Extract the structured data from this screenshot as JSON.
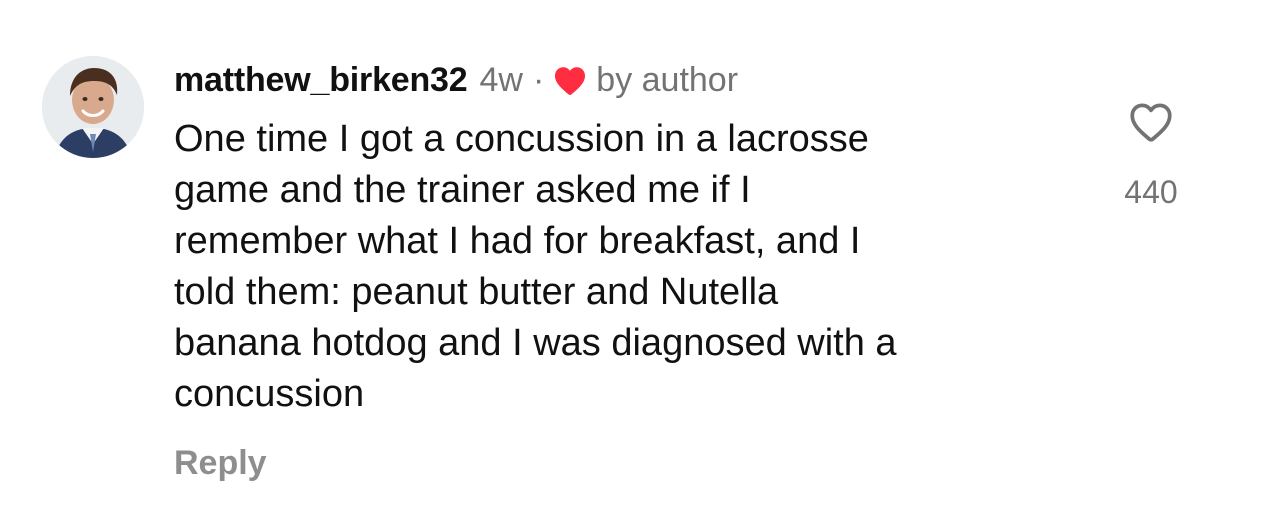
{
  "comment": {
    "username": "matthew_birken32",
    "time": "4w",
    "separator": "·",
    "by_author": "by author",
    "text": "One time I got a concussion in a lacrosse\ngame and the trainer asked me if I\nremember what I had for breakfast, and I\ntold them: peanut butter and Nutella\nbanana hotdog and I was diagnosed with a\nconcussion",
    "reply_label": "Reply",
    "like_count": "440"
  },
  "icons": {
    "avatar": "avatar",
    "author_heart": "heart-filled-icon",
    "like": "heart-outline-icon"
  },
  "colors": {
    "text": "#111111",
    "secondary": "#737373",
    "reply": "#8e8e8e",
    "author_heart": "#ff2d3f"
  }
}
